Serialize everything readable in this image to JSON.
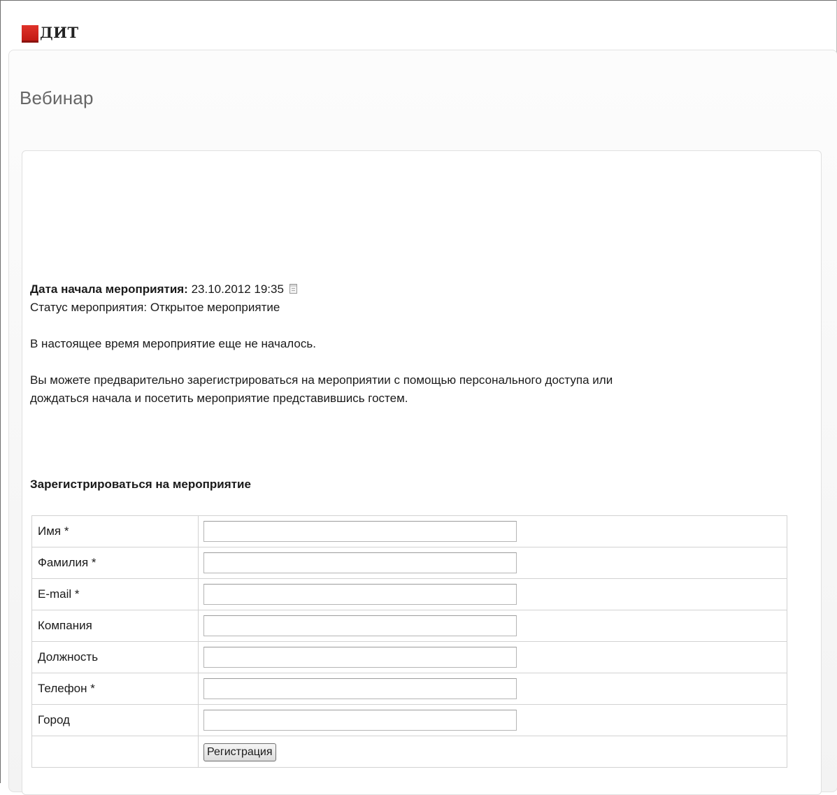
{
  "header": {
    "logo_text": "ДИТ"
  },
  "page": {
    "title": "Вебинар"
  },
  "event": {
    "start_label": "Дата начала мероприятия:",
    "start_value": "23.10.2012 19:35",
    "status_label": "Статус мероприятия:",
    "status_value": "Открытое мероприятие",
    "not_started": "В настоящее время мероприятие еще не началось.",
    "register_info_1": "Вы можете предварительно зарегистрироваться на мероприятии с помощью персонального доступа или",
    "register_info_2": "дождаться начала и посетить мероприятие представившись гостем."
  },
  "registration": {
    "heading": "Зарегистрироваться на мероприятие",
    "fields": [
      {
        "label": "Имя *",
        "value": ""
      },
      {
        "label": "Фамилия *",
        "value": ""
      },
      {
        "label": "E-mail *",
        "value": ""
      },
      {
        "label": "Компания",
        "value": ""
      },
      {
        "label": "Должность",
        "value": ""
      },
      {
        "label": "Телефон *",
        "value": ""
      },
      {
        "label": "Город",
        "value": ""
      }
    ],
    "submit_label": "Регистрация"
  },
  "colors": {
    "logo_red": "#d4241d",
    "title_gray": "#666666"
  },
  "icons": {
    "calendar": "calendar-icon"
  }
}
